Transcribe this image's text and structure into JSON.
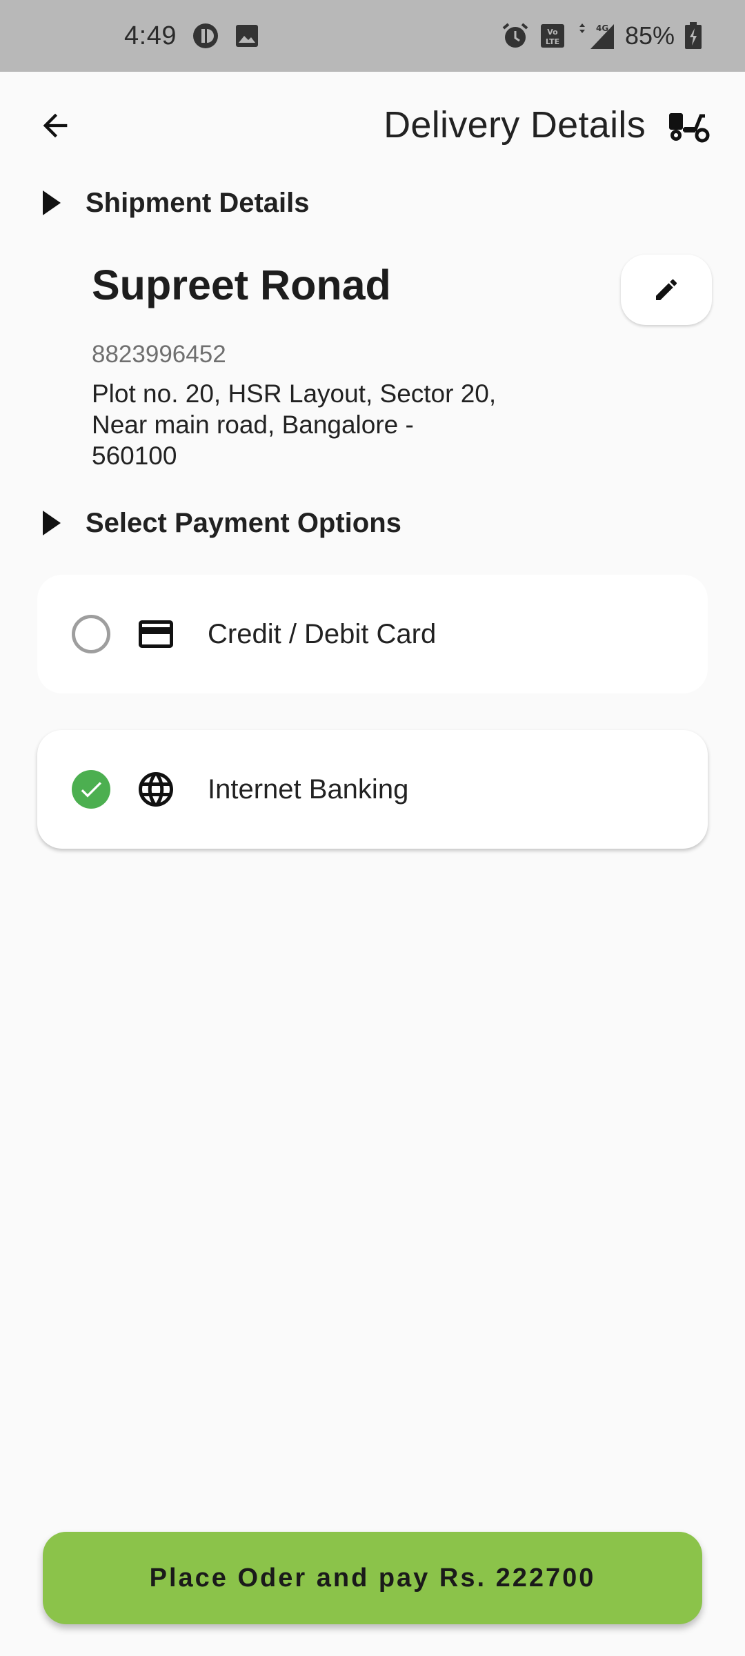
{
  "status_bar": {
    "time": "4:49",
    "battery": "85%",
    "network": "4G"
  },
  "app_bar": {
    "title": "Delivery Details"
  },
  "shipment": {
    "section_title": "Shipment Details",
    "name": "Supreet Ronad",
    "phone": "8823996452",
    "address": "Plot no. 20, HSR Layout, Sector 20, Near main road, Bangalore - 560100"
  },
  "payment": {
    "section_title": "Select Payment Options",
    "options": [
      {
        "label": "Credit / Debit Card",
        "icon": "credit-card-icon",
        "selected": false
      },
      {
        "label": "Internet Banking",
        "icon": "globe-icon",
        "selected": true
      }
    ]
  },
  "cta": {
    "label": "Place Oder and pay Rs. 222700",
    "color": "#8bc34a"
  },
  "colors": {
    "selected_radio": "#4caf50",
    "status_bar_bg": "#b8b8b8"
  }
}
